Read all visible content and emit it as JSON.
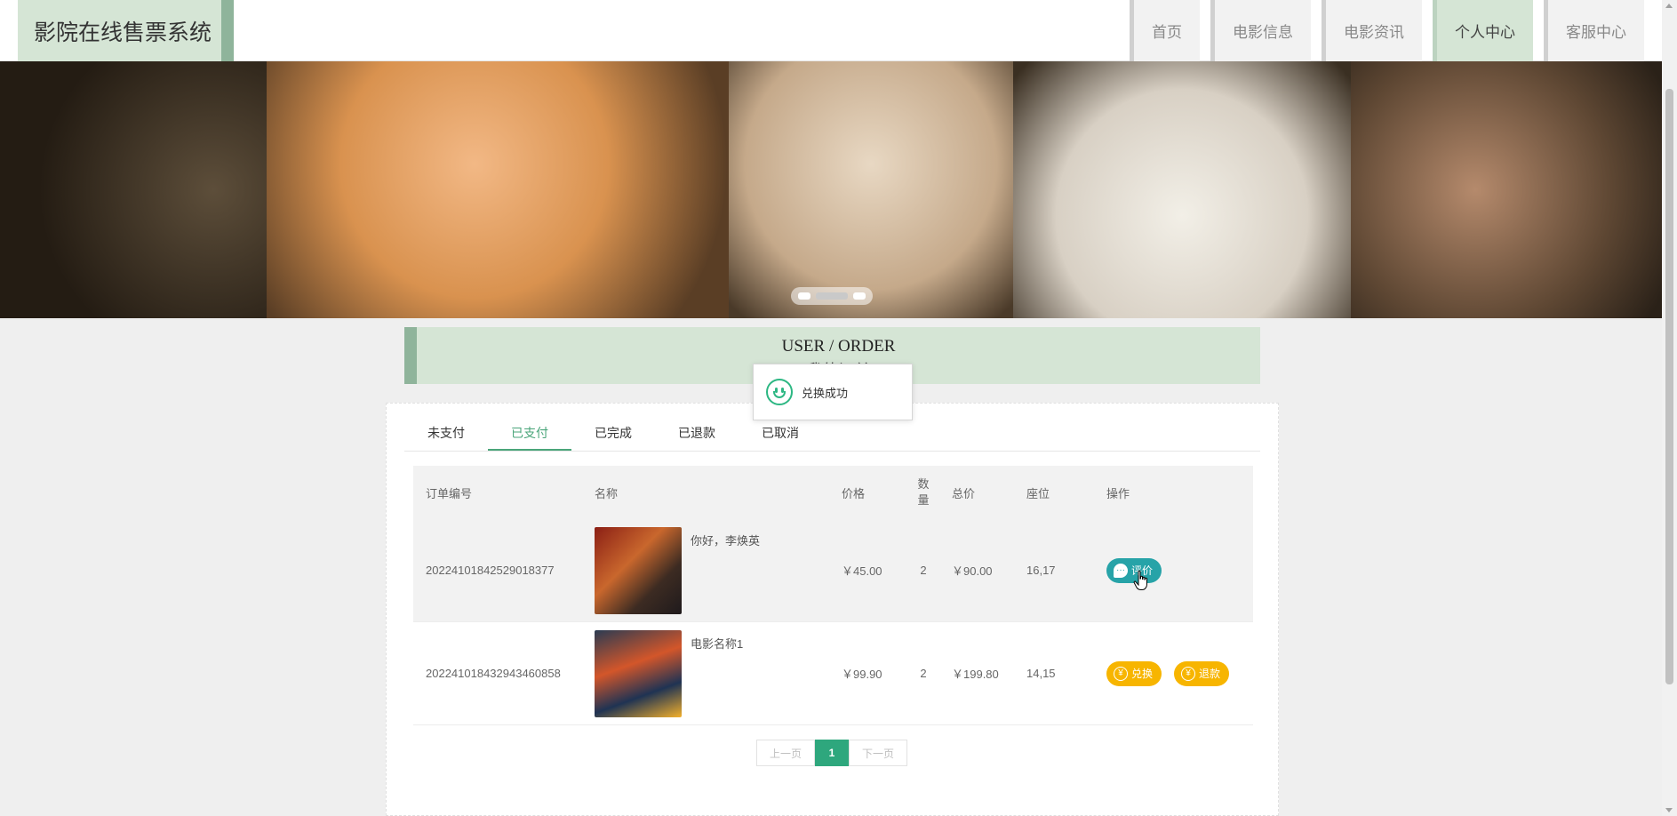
{
  "header": {
    "brand": "影院在线售票系统",
    "nav": [
      "首页",
      "电影信息",
      "电影资讯",
      "个人中心",
      "客服中心"
    ],
    "active_nav": "个人中心"
  },
  "section": {
    "title_en": "USER / ORDER",
    "title_cn": "我的订单"
  },
  "toast": {
    "text": "兑换成功",
    "icon": "smile-icon"
  },
  "tabs": [
    "未支付",
    "已支付",
    "已完成",
    "已退款",
    "已取消"
  ],
  "active_tab": "已支付",
  "table": {
    "headers": [
      "订单编号",
      "名称",
      "价格",
      "数量",
      "总价",
      "座位",
      "操作"
    ],
    "rows": [
      {
        "order_id": "20224101842529018377",
        "name": "你好，李焕英",
        "price": "￥45.00",
        "qty": "2",
        "total": "￥90.00",
        "seat": "16,17",
        "actions": [
          "评价"
        ]
      },
      {
        "order_id": "20224101843294346085​8",
        "name": "电影名称1",
        "price": "￥99.90",
        "qty": "2",
        "total": "￥199.80",
        "seat": "14,15",
        "actions": [
          "兑换",
          "退款"
        ]
      }
    ]
  },
  "pagination": {
    "prev": "上一页",
    "current": "1",
    "next": "下一页"
  },
  "colors": {
    "accent": "#8fb49b",
    "header_bg": "#d5e5d5",
    "active_tab": "#4aa57a",
    "teal_btn": "#27a3a8",
    "gold_btn": "#f7b500",
    "page_active": "#2ea77d"
  }
}
